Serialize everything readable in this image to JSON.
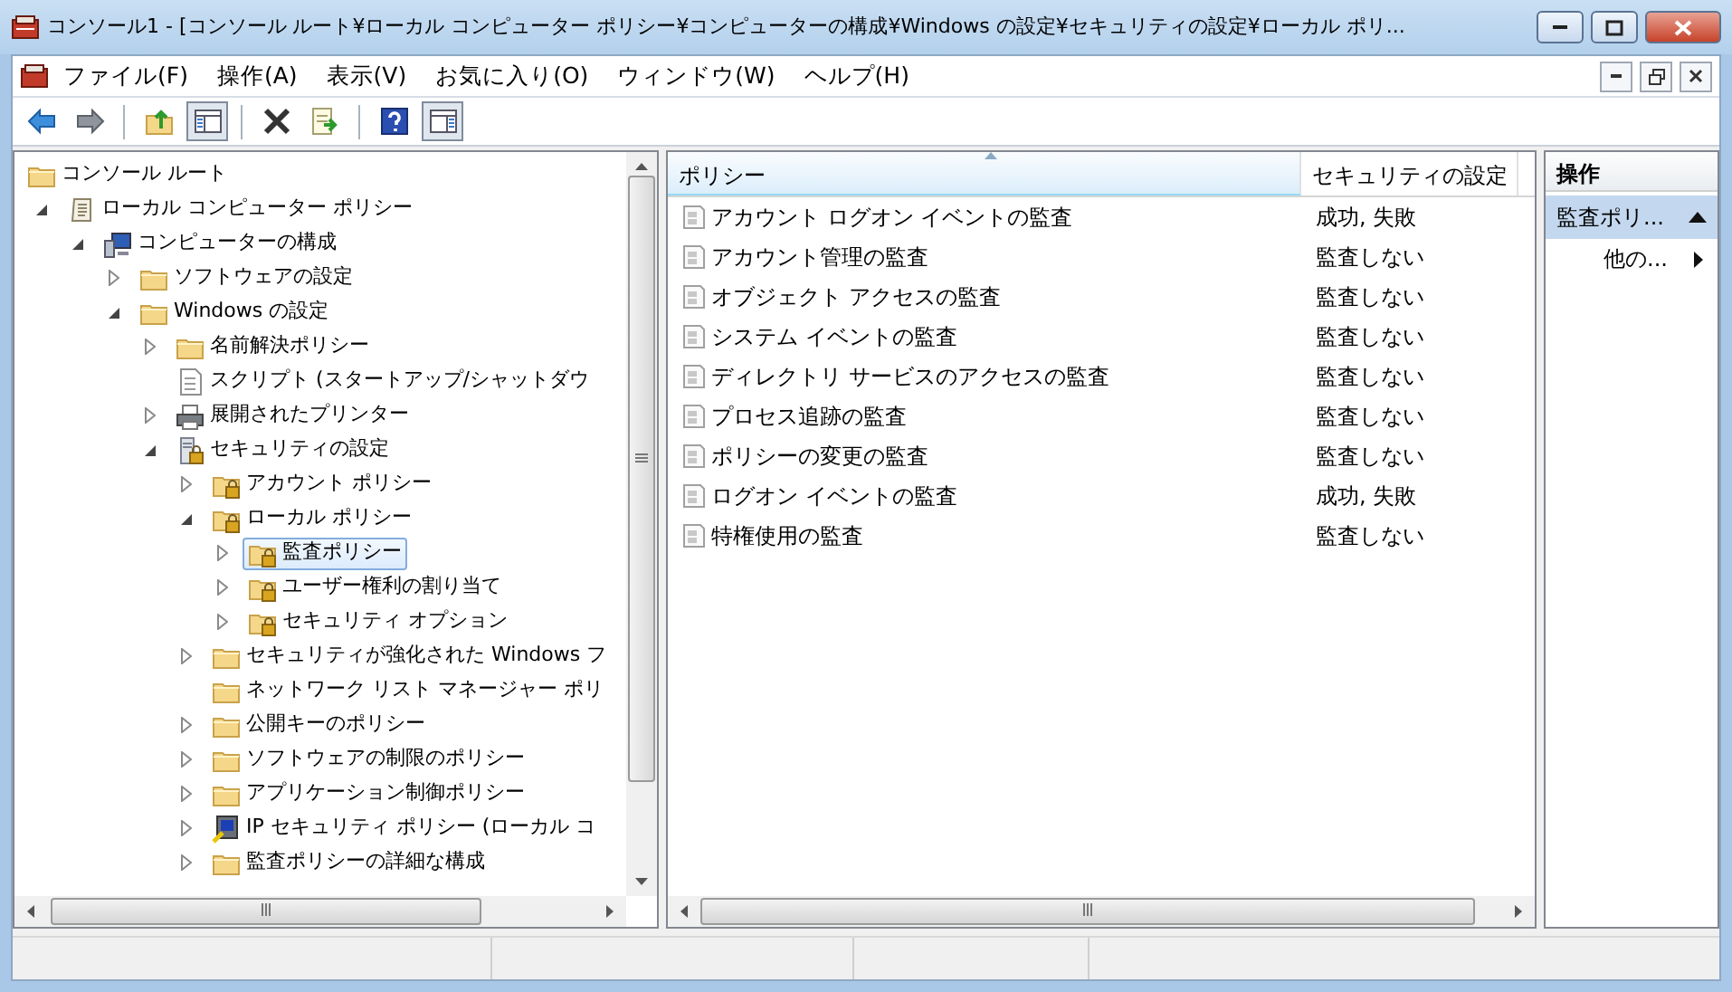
{
  "window": {
    "title": "コンソール1 - [コンソール ルート¥ローカル コンピューター ポリシー¥コンピューターの構成¥Windows の設定¥セキュリティの設定¥ローカル ポリ..."
  },
  "menu": [
    "ファイル(F)",
    "操作(A)",
    "表示(V)",
    "お気に入り(O)",
    "ウィンドウ(W)",
    "ヘルプ(H)"
  ],
  "toolbar": [
    {
      "kind": "back",
      "pressed": false
    },
    {
      "kind": "forward",
      "pressed": false
    },
    {
      "kind": "sep"
    },
    {
      "kind": "up",
      "pressed": false
    },
    {
      "kind": "tree",
      "pressed": true
    },
    {
      "kind": "sep"
    },
    {
      "kind": "delete",
      "pressed": false
    },
    {
      "kind": "export",
      "pressed": false
    },
    {
      "kind": "sep"
    },
    {
      "kind": "help",
      "pressed": false
    },
    {
      "kind": "pane",
      "pressed": true
    }
  ],
  "tree": [
    {
      "label": "コンソール ルート",
      "kind": "folder",
      "selected": false,
      "children": [
        {
          "label": "ローカル コンピューター ポリシー",
          "kind": "scroll",
          "expanded": true,
          "selected": false,
          "children": [
            {
              "label": "コンピューターの構成",
              "kind": "computer",
              "expanded": true,
              "selected": false,
              "children": [
                {
                  "label": "ソフトウェアの設定",
                  "kind": "folder",
                  "expanded": false,
                  "selected": false
                },
                {
                  "label": "Windows の設定",
                  "kind": "folder",
                  "expanded": true,
                  "selected": false,
                  "children": [
                    {
                      "label": "名前解決ポリシー",
                      "kind": "folder",
                      "expanded": false,
                      "selected": false
                    },
                    {
                      "label": "スクリプト (スタートアップ/シャットダウ",
                      "kind": "script",
                      "selected": false
                    },
                    {
                      "label": "展開されたプリンター",
                      "kind": "printer",
                      "expanded": false,
                      "selected": false
                    },
                    {
                      "label": "セキュリティの設定",
                      "kind": "security",
                      "expanded": true,
                      "selected": false,
                      "children": [
                        {
                          "label": "アカウント ポリシー",
                          "kind": "lockfolder",
                          "expanded": false,
                          "selected": false
                        },
                        {
                          "label": "ローカル ポリシー",
                          "kind": "lockfolder",
                          "expanded": true,
                          "selected": false,
                          "children": [
                            {
                              "label": "監査ポリシー",
                              "kind": "lockfolder",
                              "expanded": false,
                              "selected": true
                            },
                            {
                              "label": "ユーザー権利の割り当て",
                              "kind": "lockfolder",
                              "expanded": false,
                              "selected": false
                            },
                            {
                              "label": "セキュリティ オプション",
                              "kind": "lockfolder",
                              "expanded": false,
                              "selected": false
                            }
                          ]
                        },
                        {
                          "label": "セキュリティが強化された Windows フ",
                          "kind": "folder",
                          "expanded": false,
                          "selected": false
                        },
                        {
                          "label": "ネットワーク リスト マネージャー ポリ",
                          "kind": "folder",
                          "selected": false
                        },
                        {
                          "label": "公開キーのポリシー",
                          "kind": "folder",
                          "expanded": false,
                          "selected": false
                        },
                        {
                          "label": "ソフトウェアの制限のポリシー",
                          "kind": "folder",
                          "expanded": false,
                          "selected": false
                        },
                        {
                          "label": "アプリケーション制御ポリシー",
                          "kind": "folder",
                          "expanded": false,
                          "selected": false
                        },
                        {
                          "label": "IP セキュリティ ポリシー (ローカル コ",
                          "kind": "ipsec",
                          "expanded": false,
                          "selected": false
                        },
                        {
                          "label": "監査ポリシーの詳細な構成",
                          "kind": "folder",
                          "expanded": false,
                          "selected": false
                        }
                      ]
                    }
                  ]
                }
              ]
            }
          ]
        }
      ]
    }
  ],
  "list": {
    "columns": [
      {
        "label": "ポリシー",
        "sorted": true
      },
      {
        "label": "セキュリティの設定",
        "sorted": false
      }
    ],
    "rows": [
      {
        "policy": "アカウント ログオン イベントの監査",
        "setting": "成功, 失敗"
      },
      {
        "policy": "アカウント管理の監査",
        "setting": "監査しない"
      },
      {
        "policy": "オブジェクト アクセスの監査",
        "setting": "監査しない"
      },
      {
        "policy": "システム イベントの監査",
        "setting": "監査しない"
      },
      {
        "policy": "ディレクトリ サービスのアクセスの監査",
        "setting": "監査しない"
      },
      {
        "policy": "プロセス追跡の監査",
        "setting": "監査しない"
      },
      {
        "policy": "ポリシーの変更の監査",
        "setting": "監査しない"
      },
      {
        "policy": "ログオン イベントの監査",
        "setting": "成功, 失敗"
      },
      {
        "policy": "特権使用の監査",
        "setting": "監査しない"
      }
    ]
  },
  "actions": {
    "title": "操作",
    "section": {
      "label": "監査ポリ...",
      "expanded": true
    },
    "items": [
      "他の..."
    ]
  }
}
